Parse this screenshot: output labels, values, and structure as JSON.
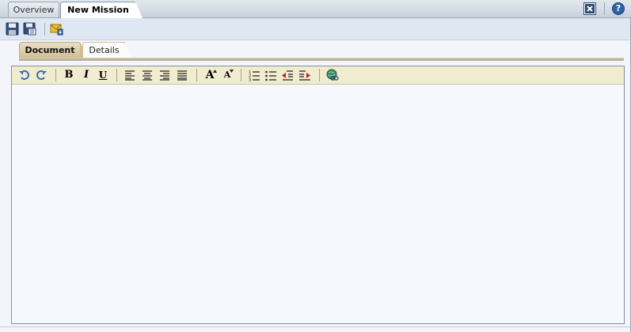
{
  "window": {
    "tabs": [
      {
        "label": "Overview"
      },
      {
        "label": "New Mission"
      }
    ],
    "help_label": "?"
  },
  "toolbar": {
    "icons": [
      "save-icon",
      "save-as-icon",
      "send-mail-icon"
    ]
  },
  "subtabs": [
    {
      "label": "Document"
    },
    {
      "label": "Details"
    }
  ],
  "editor": {
    "bold_label": "B",
    "italic_label": "I",
    "underline_label": "U",
    "font_increase_label": "A",
    "font_decrease_label": "A",
    "content": ""
  },
  "colors": {
    "tab_strip": "#cfd8e1",
    "toolbar": "#dfe8f2",
    "active_subtab": "#d8c8a0",
    "editor_toolbar": "#f0ecd0",
    "editor_bg": "#f7f7fe",
    "help_blue": "#2f62a8",
    "undo_blue": "#3a6fb5"
  }
}
